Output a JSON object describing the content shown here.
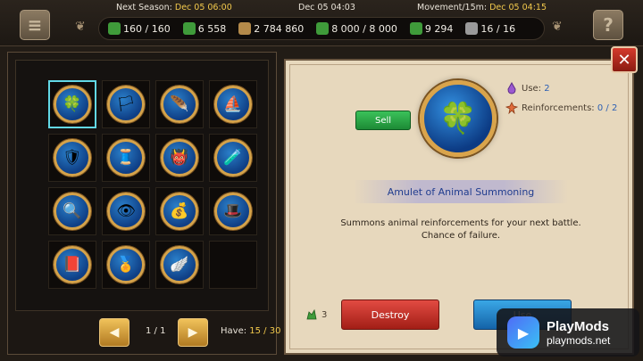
{
  "topbar": {
    "menu_icon": "hamburger-menu-icon",
    "help_label": "?",
    "next_season_label": "Next Season:",
    "next_season_value": "Dec 05 06:00",
    "current_date": "Dec 05 04:03",
    "movement_label": "Movement/15m:",
    "movement_value": "Dec 05 04:15",
    "stats": [
      {
        "icon": "boot-icon",
        "value": "160 / 160",
        "color": "#3f9b3a"
      },
      {
        "icon": "herb-icon",
        "value": "6 558",
        "color": "#3f9b3a"
      },
      {
        "icon": "money-bag-icon",
        "value": "2 784 860",
        "color": "#b48a4a"
      },
      {
        "icon": "food-bag-icon",
        "value": "8 000 / 8 000",
        "color": "#3f9b3a"
      },
      {
        "icon": "army-icon",
        "value": "9 294",
        "color": "#3f9b3a"
      },
      {
        "icon": "castle-icon",
        "value": "16 / 16",
        "color": "#9a9a9a"
      }
    ]
  },
  "inventory": {
    "slots": [
      {
        "name": "amulet-animal-summoning",
        "glyph": "🍀",
        "selected": true
      },
      {
        "name": "green-banner",
        "glyph": "🏳",
        "selected": false
      },
      {
        "name": "golden-feather",
        "glyph": "🪶",
        "selected": false
      },
      {
        "name": "sailing-ship",
        "glyph": "⛵",
        "selected": false
      },
      {
        "name": "broken-shield",
        "glyph": "🛡",
        "selected": false
      },
      {
        "name": "magic-carpet",
        "glyph": "🧵",
        "selected": false
      },
      {
        "name": "demon-mask",
        "glyph": "👹",
        "selected": false
      },
      {
        "name": "green-potion",
        "glyph": "🧪",
        "selected": false
      },
      {
        "name": "magic-mirror",
        "glyph": "🔍",
        "selected": false
      },
      {
        "name": "all-seeing-eye",
        "glyph": "👁",
        "selected": false
      },
      {
        "name": "coin-sack",
        "glyph": "💰",
        "selected": false
      },
      {
        "name": "nurse-cap",
        "glyph": "🎩",
        "selected": false
      },
      {
        "name": "spell-book",
        "glyph": "📕",
        "selected": false
      },
      {
        "name": "crest-badge",
        "glyph": "🏅",
        "selected": false
      },
      {
        "name": "silver-wings",
        "glyph": "🪽",
        "selected": false
      },
      {
        "name": "empty",
        "glyph": "",
        "selected": false
      }
    ],
    "page": "1 / 1",
    "have_label": "Have:",
    "have_value": "15 / 30",
    "prev_icon": "arrow-left-icon",
    "next_icon": "arrow-right-icon"
  },
  "detail": {
    "sell_label": "Sell",
    "use_label": "Use:",
    "use_value": "2",
    "reinforcements_label": "Reinforcements:",
    "reinforcements_value": "0 / 2",
    "item_name": "Amulet of Animal Summoning",
    "description_line1": "Summons animal reinforcements for your next battle.",
    "description_line2": "Chance of failure.",
    "army_count": "3",
    "destroy_label": "Destroy",
    "use_button_label": "Use",
    "close_icon": "close-icon"
  },
  "watermark": {
    "title": "PlayMods",
    "subtitle": "playmods.net"
  }
}
